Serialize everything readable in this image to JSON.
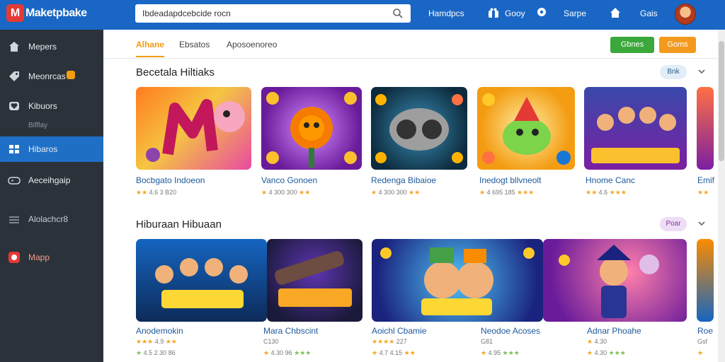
{
  "app": {
    "logo_letter": "M",
    "logo_text": "Maketpbake"
  },
  "search": {
    "value": "Ibdeadapdcebcide rocn"
  },
  "nav": {
    "items": [
      {
        "label": "Hamdpcs"
      },
      {
        "label": "Gooy"
      },
      {
        "label": "Sarpe"
      },
      {
        "label": "Gais"
      }
    ]
  },
  "sidebar": {
    "items": [
      {
        "label": "Mepers",
        "icon": "home-icon"
      },
      {
        "label": "Meonrcas",
        "icon": "tag-icon"
      },
      {
        "label": "Kibuors",
        "icon": "heart-icon",
        "sub": "Bifflay"
      },
      {
        "label": "Hibaros",
        "icon": "grid-icon"
      },
      {
        "label": "Aeceihgaip",
        "icon": "gamepad-icon"
      },
      {
        "label": "Alolachcr8",
        "icon": "list-icon"
      },
      {
        "label": "Mapp",
        "icon": "app-icon"
      }
    ]
  },
  "tabs": [
    {
      "label": "Alhane"
    },
    {
      "label": "Ebsatos"
    },
    {
      "label": "Aposoenoreo"
    }
  ],
  "actions": {
    "green_label": "Gbnes",
    "orange_label": "Goms"
  },
  "sections": [
    {
      "title": "Becetala Hiltiaks",
      "pill": "Bnk",
      "cards": [
        {
          "title": "Bocbgato Indoeon",
          "meta": "4.6 3 B20"
        },
        {
          "title": "Vanco Gonoen",
          "meta": "4 300 300"
        },
        {
          "title": "Redenga Bibaioe",
          "meta": "4 300 300"
        },
        {
          "title": "Inedogt bllvneolt",
          "meta": "4 695 185"
        },
        {
          "title": "Hnome Canc",
          "meta": "4.6"
        },
        {
          "title": "Emif",
          "meta": ""
        }
      ]
    },
    {
      "title": "Hiburaan Hibuaan",
      "pill": "Poar",
      "cards": [
        {
          "title": "Anodemokin",
          "meta": "4.9",
          "meta2": "4.5 2.30 86"
        },
        {
          "title": "Mara Chbscint",
          "meta": "C130",
          "meta2": "4.30 96"
        },
        {
          "title": "Aoichl Cbamie",
          "meta": "227",
          "meta2": "4.7 4.15"
        },
        {
          "title": "Neodoe Acoses",
          "meta": "G81",
          "meta2": "4.95"
        },
        {
          "title": "Adnar Phoahe",
          "meta": "4.30",
          "meta2": "4.30"
        },
        {
          "title": "Roe",
          "meta": "Gsf",
          "meta2": ""
        }
      ]
    }
  ],
  "colors": {
    "topbar": "#1a66c4",
    "sidebar": "#2b323a",
    "accent": "#f39c12",
    "active": "#1f6fc6"
  }
}
